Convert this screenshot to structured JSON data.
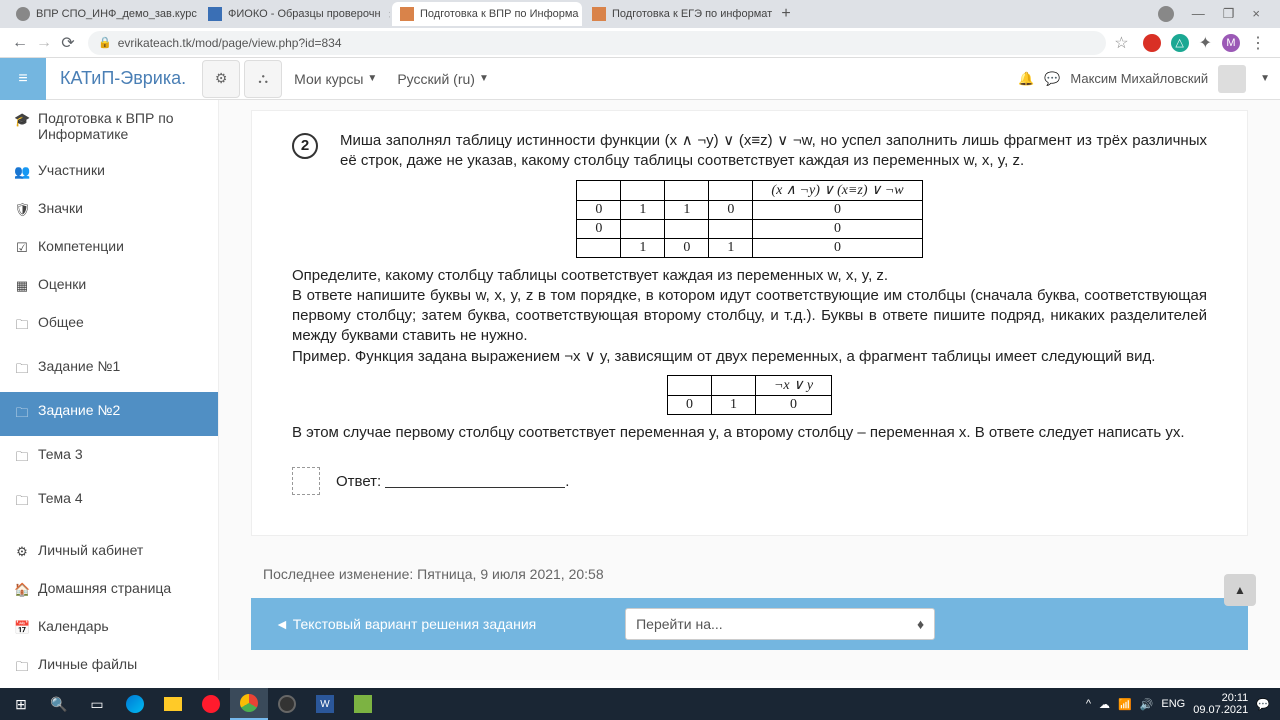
{
  "browser": {
    "tabs": [
      {
        "title": "ВПР СПО_ИНФ_демо_зав.курс"
      },
      {
        "title": "ФИОКО - Образцы проверочн"
      },
      {
        "title": "Подготовка к ВПР по Информа",
        "active": true
      },
      {
        "title": "Подготовка к ЕГЭ по информат"
      }
    ],
    "url": "evrikateach.tk/mod/page/view.php?id=834"
  },
  "header": {
    "site": "КАТиП-Эврика.",
    "menu_courses": "Мои курсы",
    "menu_lang": "Русский (ru)",
    "user": "Максим Михайловский"
  },
  "sidebar": {
    "items": [
      {
        "icon": "🎓",
        "label": "Подготовка к ВПР по Информатике"
      },
      {
        "icon": "👥",
        "label": "Участники"
      },
      {
        "icon": "🛡",
        "label": "Значки"
      },
      {
        "icon": "☑",
        "label": "Компетенции"
      },
      {
        "icon": "▦",
        "label": "Оценки"
      },
      {
        "icon": "🗀",
        "label": "Общее"
      },
      {
        "icon": "🗀",
        "label": "Задание №1"
      },
      {
        "icon": "🗀",
        "label": "Задание №2",
        "active": true
      },
      {
        "icon": "🗀",
        "label": "Тема 3"
      },
      {
        "icon": "🗀",
        "label": "Тема 4"
      }
    ],
    "bottom": [
      {
        "icon": "⚙",
        "label": "Личный кабинет"
      },
      {
        "icon": "🏠",
        "label": "Домашняя страница"
      },
      {
        "icon": "📅",
        "label": "Календарь"
      },
      {
        "icon": "🗀",
        "label": "Личные файлы"
      }
    ]
  },
  "problem": {
    "number": "2",
    "p1": "Миша заполнял таблицу истинности функции (x ∧ ¬y) ∨ (x≡z) ∨ ¬w, но успел заполнить лишь фрагмент из трёх различных её строк, даже не указав, какому столбцу таблицы соответствует каждая из переменных w, x, y, z.",
    "table1_header": "(x ∧ ¬y) ∨ (x≡z) ∨ ¬w",
    "table1": [
      [
        "0",
        "1",
        "1",
        "0",
        "0"
      ],
      [
        "0",
        "",
        "",
        "",
        "0"
      ],
      [
        "",
        "1",
        "0",
        "1",
        "0"
      ]
    ],
    "p2": "Определите, какому столбцу таблицы соответствует каждая из переменных w, x, y, z.",
    "p3": "В ответе напишите буквы w, x, y, z в том порядке, в котором идут соответствующие им столбцы (сначала буква, соответствующая первому столбцу; затем буква, соответствующая второму столбцу, и т.д.). Буквы в ответе пишите подряд, никаких разделителей между буквами ставить не нужно.",
    "p4": "Пример. Функция задана выражением ¬x ∨ y, зависящим от двух переменных, а фрагмент таблицы имеет следующий вид.",
    "table2_header": "¬x ∨ y",
    "table2": [
      [
        "0",
        "1",
        "0"
      ]
    ],
    "p5": "В этом случае первому столбцу соответствует переменная y, а второму столбцу – переменная x. В ответе следует написать yx.",
    "answer_label": "Ответ:"
  },
  "last_modified": "Последнее изменение: Пятница, 9 июля 2021, 20:58",
  "footer_nav": {
    "prev": "◄ Текстовый вариант решения задания",
    "jump": "Перейти на..."
  },
  "taskbar": {
    "lang": "ENG",
    "time": "20:11",
    "date": "09.07.2021"
  }
}
